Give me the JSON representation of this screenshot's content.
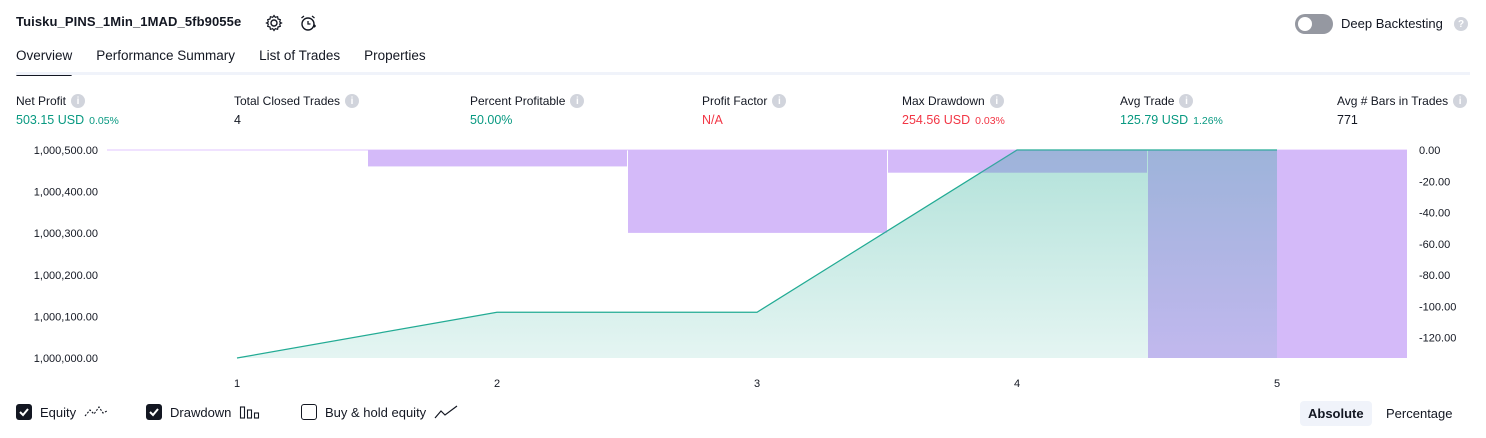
{
  "header": {
    "title": "Tuisku_PINS_1Min_1MAD_5fb9055e",
    "deep_backtesting_label": "Deep Backtesting",
    "deep_backtesting_enabled": false
  },
  "tabs": [
    {
      "label": "Overview",
      "active": true
    },
    {
      "label": "Performance Summary",
      "active": false
    },
    {
      "label": "List of Trades",
      "active": false
    },
    {
      "label": "Properties",
      "active": false
    }
  ],
  "metrics": {
    "net_profit": {
      "label": "Net Profit",
      "value": "503.15 USD",
      "pct": "0.05%"
    },
    "total_closed_trades": {
      "label": "Total Closed Trades",
      "value": "4"
    },
    "percent_profitable": {
      "label": "Percent Profitable",
      "value": "50.00%"
    },
    "profit_factor": {
      "label": "Profit Factor",
      "value": "N/A"
    },
    "max_drawdown": {
      "label": "Max Drawdown",
      "value": "254.56 USD",
      "pct": "0.03%"
    },
    "avg_trade": {
      "label": "Avg Trade",
      "value": "125.79 USD",
      "pct": "1.26%"
    },
    "avg_bars": {
      "label": "Avg # Bars in Trades",
      "value": "771"
    }
  },
  "chart_data": {
    "type": "area",
    "x": [
      1,
      2,
      3,
      4,
      5
    ],
    "x_tick_labels": [
      "1",
      "2",
      "3",
      "4",
      "5"
    ],
    "left_axis": {
      "ticks": [
        "1,000,500.00",
        "1,000,400.00",
        "1,000,300.00",
        "1,000,200.00",
        "1,000,100.00",
        "1,000,000.00"
      ],
      "ylim": [
        1000000,
        1000500
      ]
    },
    "right_axis": {
      "ticks": [
        "0.00",
        "-20.00",
        "-40.00",
        "-60.00",
        "-80.00",
        "-100.00",
        "-120.00"
      ],
      "ylim": [
        -133,
        0
      ]
    },
    "series": [
      {
        "name": "Equity",
        "values": [
          1000000,
          1000110,
          1000110,
          1000500,
          1000500
        ]
      },
      {
        "name": "Drawdown",
        "values": [
          0,
          -10.5,
          -53,
          -14.5,
          -133
        ]
      }
    ]
  },
  "legend": {
    "equity": {
      "label": "Equity",
      "checked": true
    },
    "drawdown": {
      "label": "Drawdown",
      "checked": true
    },
    "buy_hold": {
      "label": "Buy & hold equity",
      "checked": false
    }
  },
  "view_toggle": {
    "absolute": "Absolute",
    "percentage": "Percentage",
    "selected": "Absolute"
  },
  "colors": {
    "equity_line": "#22ab94",
    "drawdown_fill": "#e1c4ff",
    "positive": "#089981",
    "negative": "#f23645"
  }
}
